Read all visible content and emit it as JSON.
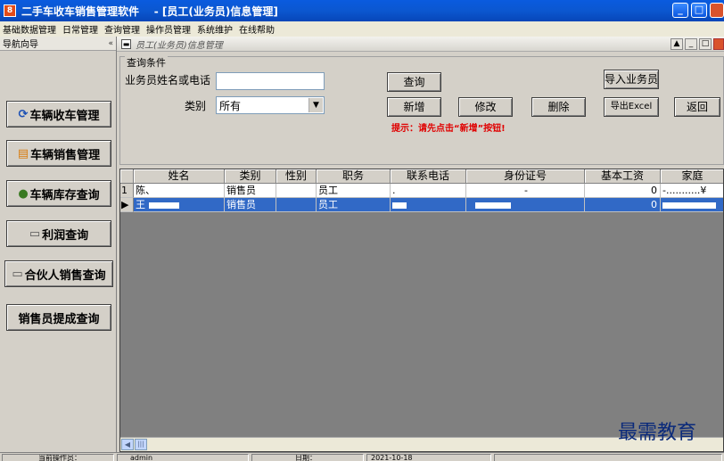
{
  "window": {
    "app_icon": "8",
    "title": "二手车收车销售管理软件    - [员工(业务员)信息管理]",
    "minimize_icon": "_",
    "maximize_icon": "□"
  },
  "menu": [
    "基础数据管理",
    "日常管理",
    "查询管理",
    "操作员管理",
    "系统维护",
    "在线帮助"
  ],
  "nav": {
    "header": "导航向导",
    "collapse": "«",
    "items": [
      {
        "label": "车辆收车管理",
        "icon": "refresh-icon",
        "glyph": "⟳"
      },
      {
        "label": "车辆销售管理",
        "icon": "tag-icon",
        "glyph": "▤"
      },
      {
        "label": "车辆库存查询",
        "icon": "money-bag-icon",
        "glyph": "●"
      },
      {
        "label": "利润查询",
        "icon": "calculator-icon",
        "glyph": "▭"
      },
      {
        "label": "合伙人销售查询",
        "icon": "report-icon",
        "glyph": "▭"
      },
      {
        "label": "销售员提成查询",
        "icon": "",
        "glyph": ""
      }
    ]
  },
  "subwindow": {
    "title": "员工(业务员)信息管理",
    "buttons": [
      "▲",
      "_",
      "□"
    ]
  },
  "query": {
    "group_title": "查询条件",
    "name_phone_label": "业务员姓名或电话",
    "name_phone_value": "",
    "category_label": "类别",
    "category_value": "所有",
    "hint": "提示：请先点击“新增”按钮!",
    "buttons": {
      "query": "查询",
      "import": "导入业务员",
      "add": "新增",
      "edit": "修改",
      "delete": "删除",
      "export": "导出Excel",
      "back": "返回"
    }
  },
  "table": {
    "columns": [
      "",
      "姓名",
      "类别",
      "性别",
      "职务",
      "联系电话",
      "身份证号",
      "基本工资",
      "家庭"
    ],
    "rows": [
      {
        "indicator": "1",
        "name": "陈、",
        "category": "销售员",
        "gender": "",
        "position": "员工",
        "phone": ".",
        "id": "-",
        "salary": "0",
        "family": "-...........¥",
        "selected": false
      },
      {
        "indicator": "▶",
        "name": "王",
        "category": "销售员",
        "gender": "",
        "position": "员工",
        "phone": "",
        "id": "",
        "salary": "0",
        "family": "",
        "selected": true
      }
    ]
  },
  "status": {
    "operator_label": "当前操作员：",
    "operator_value": "admin",
    "date_label": "日期：",
    "date_value": "2021-10-18"
  },
  "watermark": "最需教育",
  "colors": {
    "titlebar": "#0b57d0",
    "selection": "#3169c6",
    "hint": "#e00000",
    "panel": "#d4d0c8"
  }
}
